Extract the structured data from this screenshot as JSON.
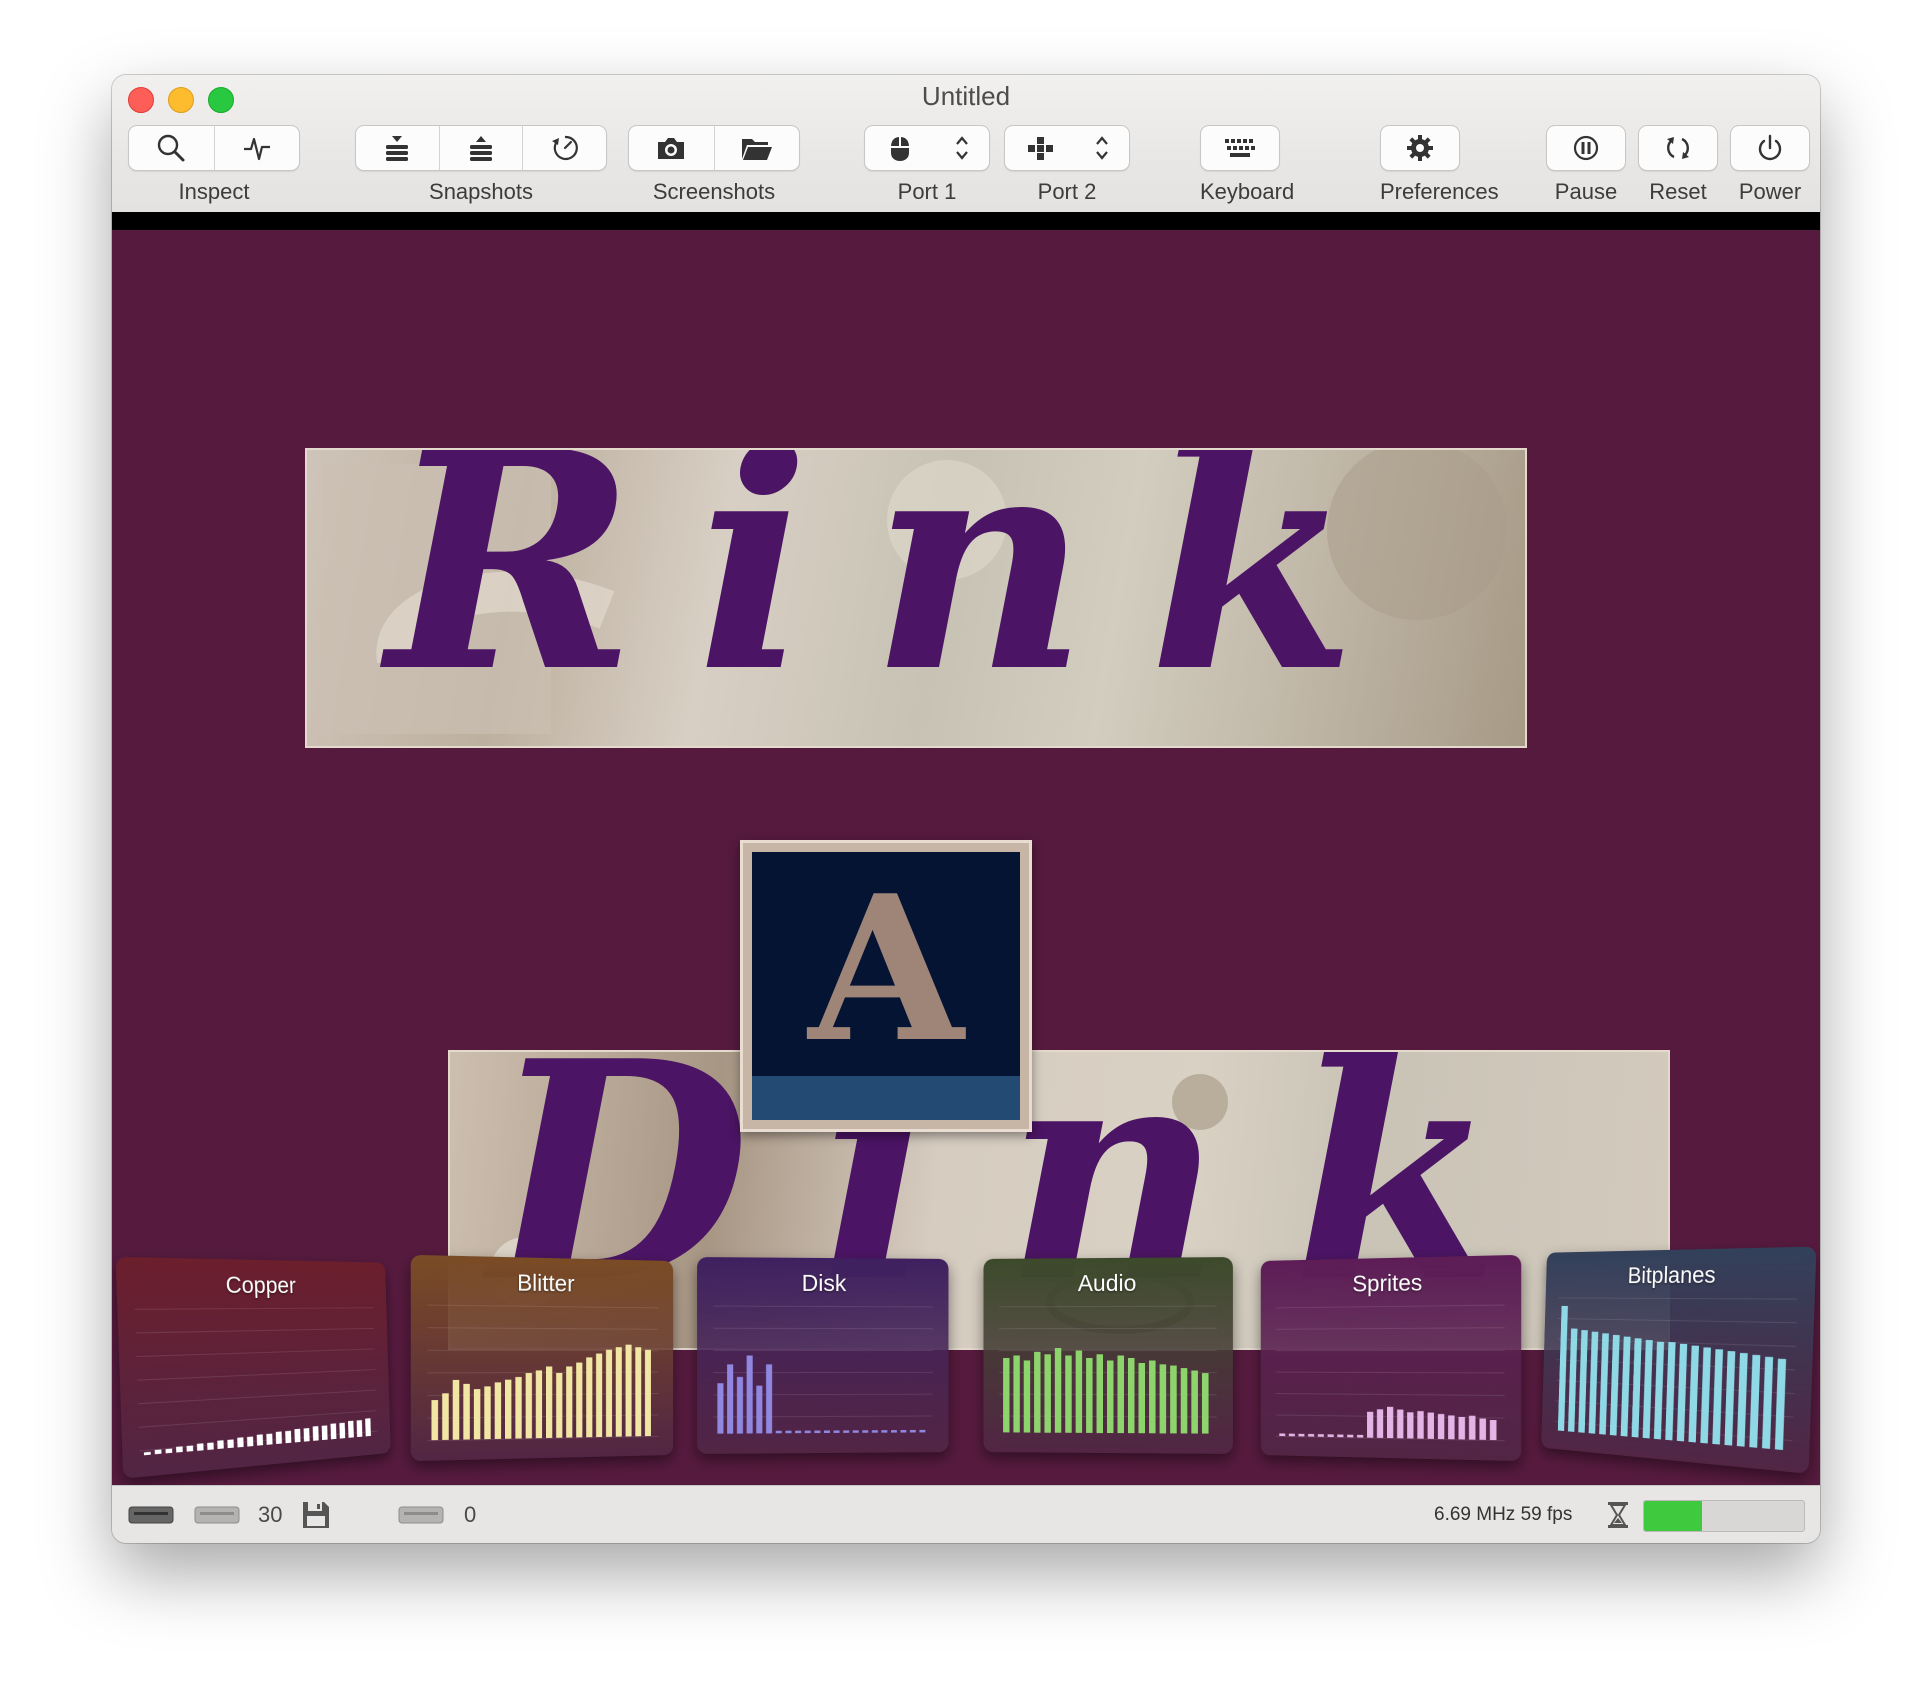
{
  "window": {
    "title": "Untitled"
  },
  "toolbar": {
    "groups": [
      {
        "label": "Inspect",
        "buttons": [
          "magnifier-icon",
          "activity-icon"
        ]
      },
      {
        "label": "Snapshots",
        "buttons": [
          "snapshot-save-icon",
          "snapshot-restore-icon",
          "snapshot-browse-icon"
        ]
      },
      {
        "label": "Screenshots",
        "buttons": [
          "camera-icon",
          "folder-icon"
        ]
      },
      {
        "label": "Port 1",
        "buttons": [
          "mouse-icon",
          "updown-chevron-icon"
        ]
      },
      {
        "label": "Port 2",
        "buttons": [
          "joystick-icon",
          "updown-chevron-icon"
        ]
      },
      {
        "label": "Keyboard",
        "buttons": [
          "keyboard-icon"
        ]
      },
      {
        "label": "Preferences",
        "buttons": [
          "gear-icon"
        ]
      },
      {
        "label": "Pause",
        "buttons": [
          "pause-icon"
        ]
      },
      {
        "label": "Reset",
        "buttons": [
          "reset-icon"
        ]
      },
      {
        "label": "Power",
        "buttons": [
          "power-icon"
        ]
      }
    ]
  },
  "screen": {
    "background": "#561a3e",
    "logo_top_text": "Rink",
    "logo_middle_text": "A",
    "logo_bottom_text": "Dink"
  },
  "monitors": [
    {
      "label": "Copper",
      "color": "#6b1e2c",
      "bar_color": "#ffffff",
      "levels": [
        0.02,
        0.03,
        0.03,
        0.04,
        0.04,
        0.05,
        0.05,
        0.06,
        0.06,
        0.07,
        0.07,
        0.08,
        0.08,
        0.09,
        0.09,
        0.1,
        0.1,
        0.11,
        0.11,
        0.12,
        0.12,
        0.13,
        0.13,
        0.14
      ]
    },
    {
      "label": "Blitter",
      "color": "#7a4b24",
      "bar_color": "#f2e6a4",
      "levels": [
        0.3,
        0.35,
        0.45,
        0.42,
        0.38,
        0.4,
        0.43,
        0.45,
        0.47,
        0.5,
        0.52,
        0.55,
        0.5,
        0.55,
        0.58,
        0.62,
        0.65,
        0.68,
        0.7,
        0.72,
        0.7,
        0.68
      ]
    },
    {
      "label": "Disk",
      "color": "#3e2060",
      "bar_color": "#8f87e0",
      "levels": [
        0.4,
        0.55,
        0.45,
        0.62,
        0.38,
        0.55,
        0.02,
        0.02,
        0.02,
        0.02,
        0.02,
        0.02,
        0.02,
        0.02,
        0.02,
        0.02,
        0.02,
        0.02,
        0.02,
        0.02,
        0.02,
        0.02
      ]
    },
    {
      "label": "Audio",
      "color": "#3c4a2a",
      "bar_color": "#8ed46c",
      "levels": [
        0.6,
        0.62,
        0.58,
        0.65,
        0.63,
        0.68,
        0.62,
        0.66,
        0.6,
        0.63,
        0.58,
        0.62,
        0.6,
        0.56,
        0.58,
        0.55,
        0.54,
        0.52,
        0.5,
        0.48
      ]
    },
    {
      "label": "Sprites",
      "color": "#5d1c56",
      "bar_color": "#e3b5e6",
      "levels": [
        0.02,
        0.02,
        0.02,
        0.02,
        0.02,
        0.02,
        0.02,
        0.02,
        0.02,
        0.2,
        0.22,
        0.24,
        0.22,
        0.2,
        0.21,
        0.2,
        0.19,
        0.18,
        0.17,
        0.18,
        0.16,
        0.15
      ]
    },
    {
      "label": "Bitplanes",
      "color": "#32405a",
      "bar_color": "#8fd9e6",
      "levels": [
        0.95,
        0.78,
        0.77,
        0.76,
        0.75,
        0.74,
        0.73,
        0.72,
        0.71,
        0.7,
        0.7,
        0.69,
        0.68,
        0.67,
        0.66,
        0.65,
        0.64,
        0.63,
        0.62,
        0.61
      ]
    }
  ],
  "statusbar": {
    "drive_count": "30",
    "df1_count": "0",
    "speed_text": "6.69 MHz 59 fps",
    "speed_fill": 0.36,
    "speed_color": "#3fc93f"
  }
}
